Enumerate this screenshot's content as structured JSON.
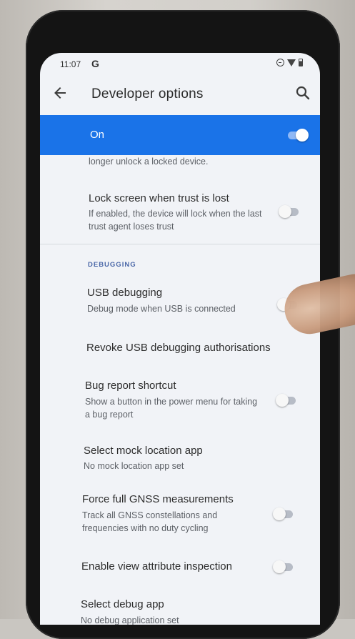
{
  "status_bar": {
    "time": "11:07",
    "g_label": "G",
    "icons": [
      "dnd-icon",
      "wifi-icon",
      "battery-icon"
    ]
  },
  "app_bar": {
    "title": "Developer options",
    "back_icon": "back-arrow-icon",
    "search_icon": "search-icon"
  },
  "master": {
    "label": "On",
    "enabled": true
  },
  "colors": {
    "accent": "#1a73e8",
    "section_header": "#4a67a8"
  },
  "items": {
    "partial": {
      "subtitle": "longer unlock a locked device."
    },
    "lock_screen": {
      "title": "Lock screen when trust is lost",
      "subtitle": "If enabled, the device will lock when the last trust agent loses trust",
      "enabled": false
    },
    "debugging_header": "DEBUGGING",
    "usb_debugging": {
      "title": "USB debugging",
      "subtitle": "Debug mode when USB is connected",
      "enabled": false
    },
    "revoke": {
      "title": "Revoke USB debugging authorisations"
    },
    "bug_report": {
      "title": "Bug report shortcut",
      "subtitle": "Show a button in the power menu for taking a bug report",
      "enabled": false
    },
    "mock_location": {
      "title": "Select mock location app",
      "subtitle": "No mock location app set"
    },
    "gnss": {
      "title": "Force full GNSS measurements",
      "subtitle": "Track all GNSS constellations and frequencies with no duty cycling",
      "enabled": false
    },
    "view_attr": {
      "title": "Enable view attribute inspection",
      "enabled": false
    },
    "debug_app": {
      "title": "Select debug app",
      "subtitle": "No debug application set"
    }
  }
}
